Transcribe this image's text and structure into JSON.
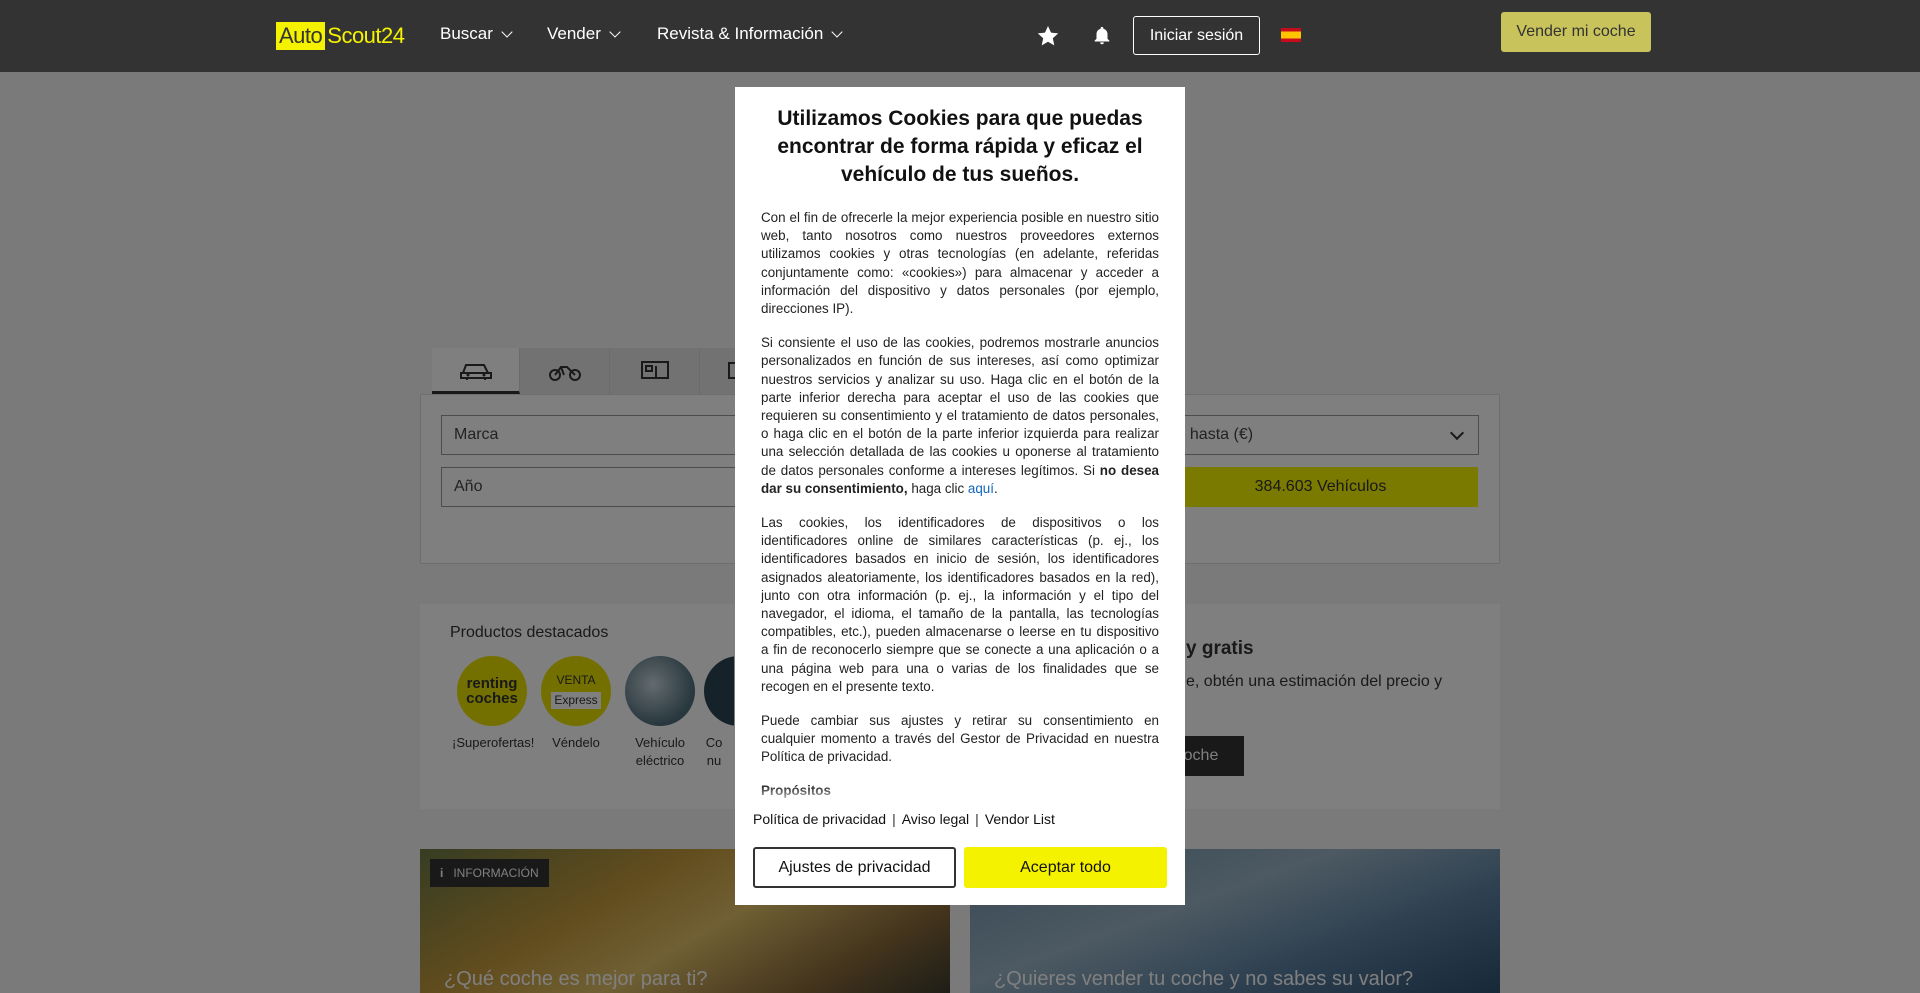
{
  "header": {
    "logo_left": "Auto",
    "logo_right": "Scout24",
    "nav": [
      "Buscar",
      "Vender",
      "Revista & Información"
    ],
    "login_label": "Iniciar sesión",
    "sell_label": "Vender mi coche",
    "icons": [
      "star-icon",
      "bell-icon",
      "spain-flag-icon"
    ]
  },
  "search": {
    "make_placeholder": "Marca",
    "year_placeholder": "Año",
    "price_partial": "io hasta (€)",
    "results_label": "384.603 Vehículos"
  },
  "products": {
    "title": "Productos destacados",
    "items": [
      {
        "line1": "renting",
        "line2": "coches",
        "label": "¡Superofertas!"
      },
      {
        "line1": "VENTA",
        "line2": "Express",
        "label": "Véndelo"
      },
      {
        "line1": "",
        "line2": "",
        "label": "Vehículo eléctrico"
      },
      {
        "line1": "",
        "line2": "",
        "label": "Co nu"
      }
    ],
    "right_title": "y gratis",
    "right_text": "e, obtén una estimación del precio y",
    "right_button": "coche"
  },
  "articles": [
    {
      "badge": "INFORMACIÓN",
      "title": "¿Qué coche es mejor para ti?"
    },
    {
      "badge": "",
      "title": "¿Quieres vender tu coche y no sabes su valor?"
    }
  ],
  "cookie_modal": {
    "title": "Utilizamos Cookies para que puedas encontrar de forma rápida y eficaz el vehículo de tus sueños.",
    "p1": "Con el fin de ofrecerle la mejor experiencia posible en nuestro sitio web, tanto nosotros como nuestros proveedores externos utilizamos cookies y otras tecnologías (en adelante, referidas conjuntamente como: «cookies») para almacenar y acceder a información del dispositivo y datos personales (por ejemplo, direcciones IP).",
    "p2": "Si consiente el uso de las cookies, podremos mostrarle anuncios personalizados en función de sus intereses, así como optimizar nuestros servicios y analizar su uso. Haga clic en el botón de la parte inferior derecha para aceptar el uso de las cookies que requieren su consentimiento y el tratamiento de datos personales, o haga clic en el botón de la parte inferior izquierda para realizar una selección detallada de las cookies u oponerse al tratamiento de datos personales conforme a intereses legítimos. Si",
    "p2_bold": "no desea dar su consentimiento,",
    "p2_tail": "haga clic",
    "p2_link": "aquí",
    "p3": "Las cookies, los identificadores de dispositivos o los identificadores online de similares características (p. ej., los identificadores basados en inicio de sesión, los identificadores asignados aleatoriamente, los identificadores basados en la red), junto con otra información (p. ej., la información y el tipo del navegador, el idioma, el tamaño de la pantalla, las tecnologías compatibles, etc.), pueden almacenarse o leerse en tu dispositivo a fin de reconocerlo siempre que se conecte a una aplicación o a una página web para una o varias de los finalidades que se recogen en el presente texto.",
    "p4": "Puede cambiar sus ajustes y retirar su consentimiento en cualquier momento a través del Gestor de Privacidad en nuestra Política de privacidad.",
    "section": "Propósitos",
    "links": [
      "Política de privacidad",
      "Aviso legal",
      "Vendor List"
    ],
    "settings_button": "Ajustes de privacidad",
    "accept_button": "Aceptar todo"
  }
}
